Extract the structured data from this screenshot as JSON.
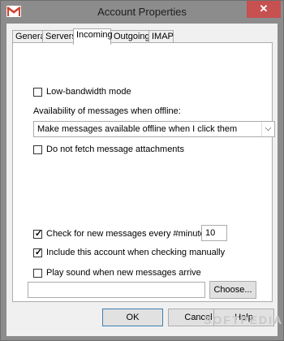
{
  "window": {
    "title": "Account Properties",
    "close_glyph": "✕",
    "icon": "gmail-envelope-icon"
  },
  "tabs": [
    {
      "label": "General",
      "active": false
    },
    {
      "label": "Servers",
      "active": false
    },
    {
      "label": "Incoming",
      "active": true
    },
    {
      "label": "Outgoing",
      "active": false
    },
    {
      "label": "IMAP",
      "active": false
    }
  ],
  "incoming": {
    "low_bandwidth": {
      "label": "Low-bandwidth mode",
      "checked": false
    },
    "offline_label": "Availability of messages when offline:",
    "offline_select": {
      "value": "Make messages available offline when I click them"
    },
    "no_attachments": {
      "label": "Do not fetch message attachments",
      "checked": false
    },
    "check_new": {
      "label": "Check for new messages every #minutes",
      "checked": true,
      "minutes": "10"
    },
    "include_manual": {
      "label": "Include this account when checking manually",
      "checked": true
    },
    "play_sound": {
      "label": "Play sound when new messages arrive",
      "checked": false
    },
    "sound_path": "",
    "choose_label": "Choose..."
  },
  "footer": {
    "ok_label": "OK",
    "cancel_label": "Cancel",
    "help_label": "Help"
  },
  "watermark": "SOFTPEDIA",
  "colors": {
    "close_button": "#c75050",
    "titlebar": "#8c8c8c",
    "dialog_bg": "#f0f0f0"
  }
}
